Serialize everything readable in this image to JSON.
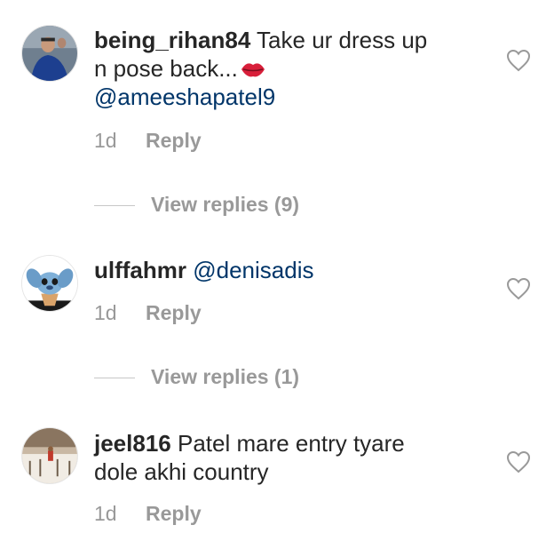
{
  "comments": [
    {
      "username": "being_rihan84",
      "text_line1": "Take ur dress up",
      "text_line2": "n pose back...",
      "emoji": "lips-emoji",
      "mention": "@ameeshapatel9",
      "time": "1d",
      "reply_label": "Reply",
      "view_replies": "View replies (9)"
    },
    {
      "username": "ulffahmr",
      "mention": "@denisadis",
      "time": "1d",
      "reply_label": "Reply",
      "view_replies": "View replies (1)"
    },
    {
      "username": "jeel816",
      "text_line1": "Patel mare entry tyare",
      "text_line2": "dole akhi country",
      "time": "1d",
      "reply_label": "Reply"
    }
  ],
  "icons": {
    "like": "heart-outline-icon"
  },
  "colors": {
    "text": "#262626",
    "mention": "#003569",
    "meta": "#999999"
  }
}
